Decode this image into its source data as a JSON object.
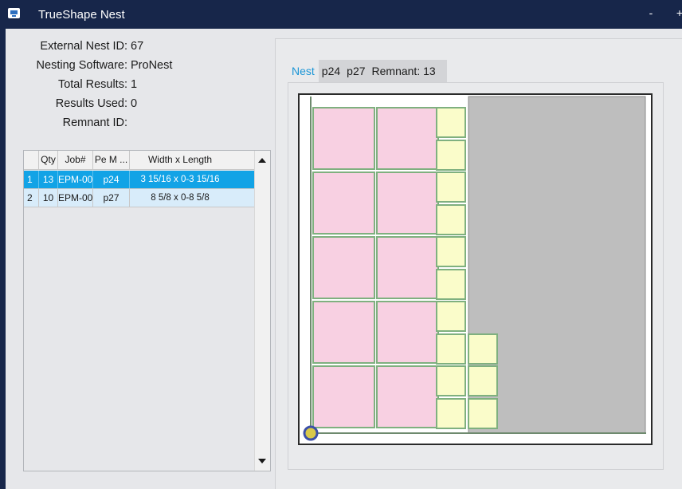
{
  "window": {
    "title": "TrueShape Nest",
    "minimize_label": "-",
    "maximize_label": "+"
  },
  "info": {
    "external_nest_id_label": "External Nest ID:",
    "external_nest_id": "67",
    "nesting_software_label": "Nesting Software:",
    "nesting_software": "ProNest",
    "total_results_label": "Total Results:",
    "total_results": "1",
    "results_used_label": "Results Used:",
    "results_used": "0",
    "remnant_id_label": "Remnant ID:",
    "remnant_id": ""
  },
  "grid": {
    "columns": [
      "",
      "Qty",
      "Job#",
      "Pe M ...",
      "Width x Length"
    ],
    "rows": [
      {
        "index": "1",
        "qty": "13",
        "job": "EPM-00",
        "part": "p24",
        "size": "3 15/16 x 0-3 15/16",
        "selected": true
      },
      {
        "index": "2",
        "qty": "10",
        "job": "EPM-00",
        "part": "p27",
        "size": "8 5/8 x 0-8 5/8",
        "selected": false
      }
    ]
  },
  "tabs": [
    {
      "label": "Nest",
      "active": true
    },
    {
      "label": "p24",
      "active": false
    },
    {
      "label": "p27",
      "active": false
    },
    {
      "label": "Remnant: 13",
      "active": false
    }
  ],
  "colors": {
    "titlebar": "#17264a",
    "selection": "#12a3e6",
    "large_part": "#f8d0e2",
    "small_part": "#fafcca",
    "part_border": "#7fb07f",
    "remnant": "#bebebe"
  },
  "nest": {
    "large_part_count": 10,
    "small_part_count": 13,
    "large_part_label": "p27",
    "small_part_label": "p24"
  }
}
